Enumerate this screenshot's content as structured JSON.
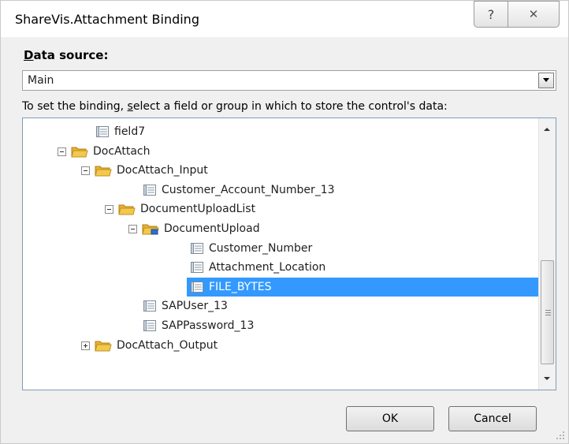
{
  "window": {
    "title": "ShareVis.Attachment Binding",
    "help_glyph": "?",
    "close_glyph": "✕"
  },
  "data_source": {
    "label": "Data source:",
    "value": "Main"
  },
  "instruction": "To set the binding, select a field or group in which to store the control's data:",
  "tree": [
    {
      "label": "field7",
      "type": "field",
      "level": 1,
      "expander": "none"
    },
    {
      "label": "DocAttach",
      "type": "group",
      "level": 0,
      "expander": "minus"
    },
    {
      "label": "DocAttach_Input",
      "type": "group",
      "level": 1,
      "expander": "minus"
    },
    {
      "label": "Customer_Account_Number_13",
      "type": "field",
      "level": 3,
      "expander": "none"
    },
    {
      "label": "DocumentUploadList",
      "type": "group",
      "level": 2,
      "expander": "minus"
    },
    {
      "label": "DocumentUpload",
      "type": "repeating-group",
      "level": 3,
      "expander": "minus"
    },
    {
      "label": "Customer_Number",
      "type": "field",
      "level": 5,
      "expander": "none"
    },
    {
      "label": "Attachment_Location",
      "type": "field",
      "level": 5,
      "expander": "none"
    },
    {
      "label": "FILE_BYTES",
      "type": "field",
      "level": 5,
      "expander": "none",
      "selected": true
    },
    {
      "label": "SAPUser_13",
      "type": "field",
      "level": 3,
      "expander": "none"
    },
    {
      "label": "SAPPassword_13",
      "type": "field",
      "level": 3,
      "expander": "none"
    },
    {
      "label": "DocAttach_Output",
      "type": "group",
      "level": 1,
      "expander": "plus"
    }
  ],
  "buttons": {
    "ok": "OK",
    "cancel": "Cancel"
  },
  "colors": {
    "selection": "#3399ff",
    "folder": "#f2c94c"
  }
}
